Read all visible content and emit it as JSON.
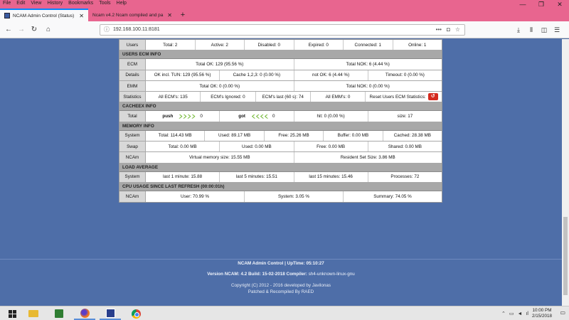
{
  "browser": {
    "menu": [
      "File",
      "Edit",
      "View",
      "History",
      "Bookmarks",
      "Tools",
      "Help"
    ],
    "tabs": [
      {
        "title": "NCAM Admin Control (Status)",
        "active": true
      },
      {
        "title": "Ncam v4.2 Ncam compiled and pa",
        "active": false
      }
    ],
    "url": "192.168.100.11:8181",
    "url_tools": [
      "•••",
      "◘",
      "☆"
    ],
    "window_controls": [
      "—",
      "❐",
      "✕"
    ]
  },
  "status": {
    "users": {
      "label": "Users",
      "cells": [
        "Total: 2",
        "Active: 2",
        "Disabled: 0",
        "Expired: 0",
        "Connected: 1",
        "Online: 1"
      ]
    },
    "ecm_header": "USERS ECM INFO",
    "ecm": {
      "label": "ECM",
      "cells": [
        "Total OK: 129 (95.56 %)",
        "Total NOK: 6 (4.44 %)"
      ]
    },
    "details": {
      "label": "Details",
      "cells": [
        "OK incl. TUN: 129 (95.56 %)",
        "Cache 1,2,3: 0 (0.00 %)",
        "not OK: 6 (4.44 %)",
        "Timeout: 0 (0.00 %)"
      ]
    },
    "emm": {
      "label": "EMM",
      "cells": [
        "Total OK: 0 (0.00 %)",
        "Total NOK: 0 (0.00 %)"
      ]
    },
    "statistics": {
      "label": "Statistics",
      "cells": [
        "All ECM's: 135",
        "ECM's Ignored: 0",
        "ECM's last (60 s): 74",
        "All EMM's: 0",
        "Reset Users ECM Statistics:"
      ]
    },
    "cacheex_header": "CACHEEX INFO",
    "cacheex": {
      "label": "Total",
      "push_label": "push",
      "push_value": "0",
      "got_label": "got",
      "got_value": "0",
      "hit": "hit: 0 (0.00 %)",
      "size": "size: 17"
    },
    "memory_header": "MEMORY INFO",
    "system": {
      "label": "System",
      "cells": [
        "Total: 114.43 MB",
        "Used: 89.17 MB",
        "Free: 25.26 MB",
        "Buffer: 0.00 MB",
        "Cached: 28.38 MB"
      ]
    },
    "swap": {
      "label": "Swap",
      "cells": [
        "Total: 0.00 MB",
        "Used: 0.00 MB",
        "Free: 0.00 MB",
        "Shared: 0.00 MB"
      ]
    },
    "ncam_mem": {
      "label": "NCAm",
      "cells": [
        "Virtual memory size: 15.55 MB",
        "Resident Set Size: 3.86 MB"
      ]
    },
    "load_header": "LOAD AVERAGE",
    "load": {
      "label": "System",
      "cells": [
        "last 1 minute: 15.88",
        "last 5 minutes: 15.51",
        "last 15 minutes: 15.46",
        "Processes: 72"
      ]
    },
    "cpu_header": "CPU USAGE SINCE LAST REFRESH (00:00:01h)",
    "cpu": {
      "label": "NCAm",
      "cells": [
        "User: 70.99 %",
        "System: 3.05 %",
        "Summary: 74.05 %"
      ]
    }
  },
  "footer": {
    "line1": "NCAM Admin Control | UpTime: 05:10:27",
    "line2_a": "Version NCAM: 4.2 Build: 15-02-2018 Compiler:",
    "line2_b": "sh4-unknown-linux-gnu",
    "line3": "Copyright (C) 2012 - 2016 developed by Javilonas",
    "line4": "Patched & Recompiled By RAED"
  },
  "taskbar": {
    "clock_time": "10:00 PM",
    "clock_date": "2/15/2018"
  },
  "colors": {
    "page_bg": "#4e6ea8",
    "titlebar": "#e8658f",
    "header_row": "#a8a8a8",
    "reset_button": "#d42a1e"
  }
}
